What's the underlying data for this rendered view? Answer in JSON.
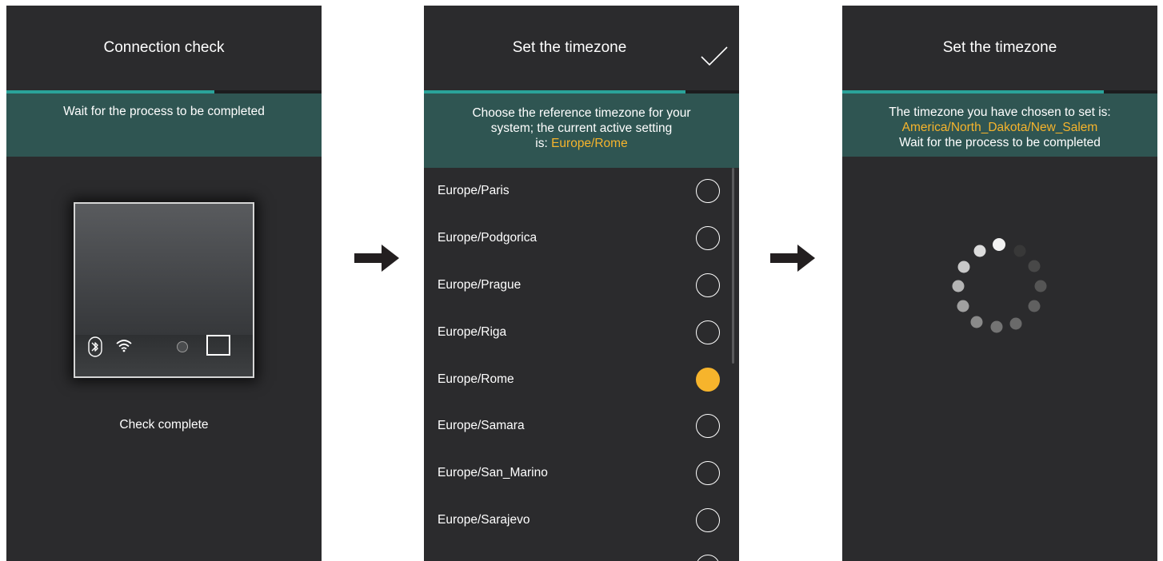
{
  "screen1": {
    "title": "Connection check",
    "progress": 0.66,
    "banner": "Wait for the process to be completed",
    "caption": "Check complete"
  },
  "screen2": {
    "title": "Set the timezone",
    "progress": 0.83,
    "banner_text": "Choose the reference timezone for your system; the current active setting is: ",
    "banner_line1": "Choose the reference timezone for your",
    "banner_line2": "system; the current active setting",
    "banner_line3_prefix": "is: ",
    "current_timezone": "Europe/Rome",
    "timezones": [
      {
        "label": "Europe/Paris",
        "selected": false
      },
      {
        "label": "Europe/Podgorica",
        "selected": false
      },
      {
        "label": "Europe/Prague",
        "selected": false
      },
      {
        "label": "Europe/Riga",
        "selected": false
      },
      {
        "label": "Europe/Rome",
        "selected": true
      },
      {
        "label": "Europe/Samara",
        "selected": false
      },
      {
        "label": "Europe/San_Marino",
        "selected": false
      },
      {
        "label": "Europe/Sarajevo",
        "selected": false
      }
    ]
  },
  "screen3": {
    "title": "Set the timezone",
    "progress": 0.83,
    "banner_line1": "The timezone you have chosen to set is:",
    "chosen_timezone": "America/North_Dakota/New_Salem",
    "banner_line3": "Wait for the process to be completed"
  },
  "colors": {
    "accent": "#2aa39a",
    "highlight": "#f6b42c",
    "screen_bg": "#2b2b2d",
    "banner_bg": "#2f5552"
  },
  "icons": [
    "check-icon",
    "bluetooth-icon",
    "wifi-icon",
    "arrow-right-icon",
    "loading-spinner-icon"
  ]
}
